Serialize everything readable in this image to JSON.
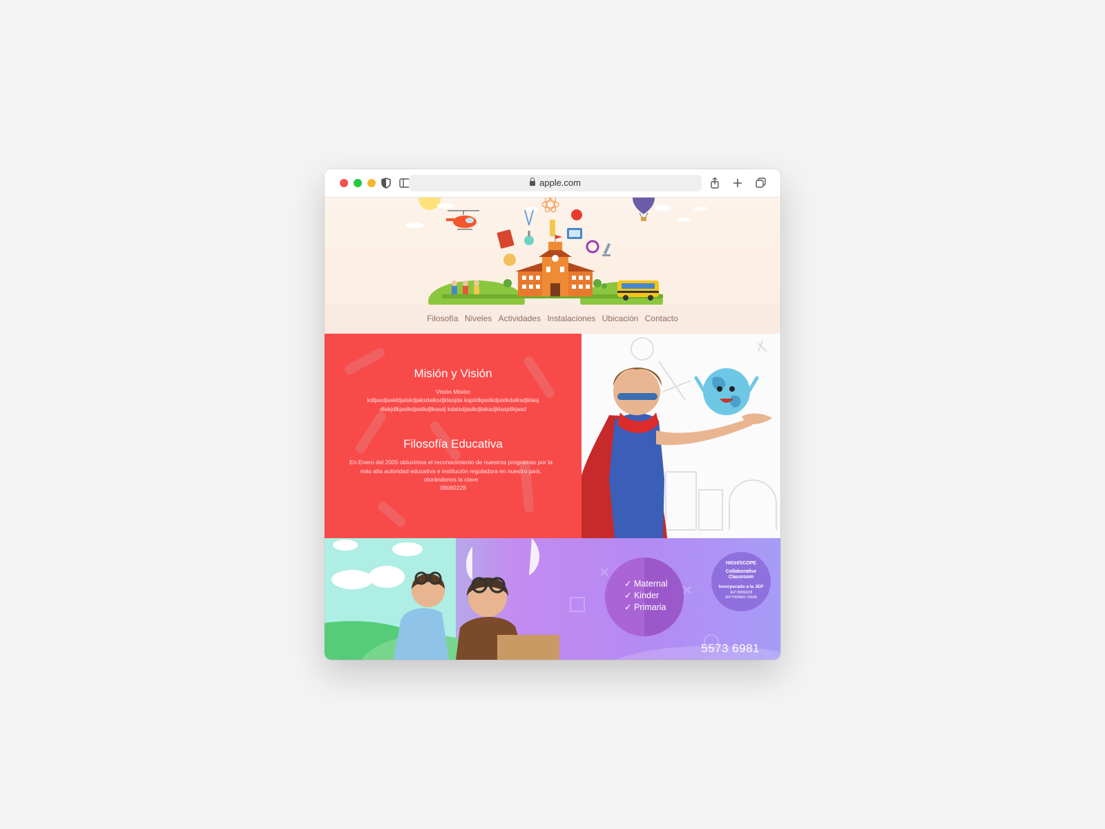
{
  "browser": {
    "url": "apple.com"
  },
  "nav": {
    "items": [
      "Filosofía",
      "Niveles",
      "Actividades",
      "Instalaciones",
      "Ubicación",
      "Contacto"
    ]
  },
  "mission": {
    "title": "Misión y Visión",
    "subtitle": "Visión Misión",
    "body": "kdljasdjaskldjalskdjaksdalksdjklasjda kajsldkjaslkdjaslkdalksdjklasjdlakjdlkjaslkdjaslkdjlkasdj kdalsdjaslkdjlakadjklasjdlkjasd"
  },
  "philosophy": {
    "title": "Filosofía Educativa",
    "body": "En Enero del 2005 obtuvimos el reconocimiento de nuestros programas por la más alta autoridad educativa e institución reguladora en nuestro país, otorándonos la clave",
    "code": "09060228"
  },
  "levels": [
    "Maternal",
    "Kinder",
    "Primaria"
  ],
  "badge": {
    "top": "HIGH/SCOPE",
    "name": "Collaborative Classroom",
    "line1": "Incorporado a la JEP",
    "line2": "JEP 09060228",
    "line3": "JEP PRIMER: 60645"
  },
  "phone": "5573 6981",
  "colors": {
    "hero_bg": "#fdf3ea",
    "nav_bg": "#f9ebe1",
    "red": "#f94a4a",
    "purple": "#c38bf1",
    "teal": "#9ce7d8"
  }
}
